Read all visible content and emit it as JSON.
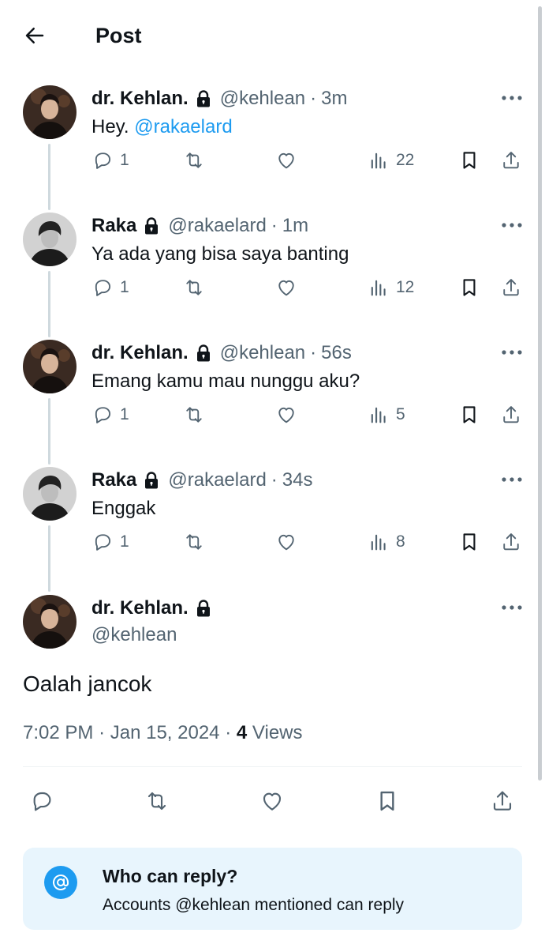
{
  "header": {
    "title": "Post"
  },
  "replies": [
    {
      "name": "dr. Kehlan.",
      "handle": "@kehlean",
      "time": "3m",
      "text": "Hey.",
      "mention": "@rakaelard",
      "reply_count": "1",
      "views": "22",
      "avatar": "dark-portrait"
    },
    {
      "name": "Raka",
      "handle": "@rakaelard",
      "time": "1m",
      "text": "Ya ada yang bisa saya banting",
      "mention": "",
      "reply_count": "1",
      "views": "12",
      "avatar": "grey-portrait"
    },
    {
      "name": "dr. Kehlan.",
      "handle": "@kehlean",
      "time": "56s",
      "text": "Emang kamu mau nunggu aku?",
      "mention": "",
      "reply_count": "1",
      "views": "5",
      "avatar": "dark-portrait"
    },
    {
      "name": "Raka",
      "handle": "@rakaelard",
      "time": "34s",
      "text": "Enggak",
      "mention": "",
      "reply_count": "1",
      "views": "8",
      "avatar": "grey-portrait"
    }
  ],
  "main_tweet": {
    "name": "dr. Kehlan.",
    "handle": "@kehlean",
    "text": "Oalah jancok",
    "time": "7:02 PM",
    "date": "Jan 15, 2024",
    "views_count": "4",
    "views_label": "Views"
  },
  "who_can_reply": {
    "title": "Who can reply?",
    "description": "Accounts @kehlean mentioned can reply"
  },
  "colors": {
    "accent": "#1d9bf0",
    "muted": "#536471",
    "text": "#0f1419",
    "card_bg": "#e8f5fd"
  },
  "icons": [
    "arrow-left-icon",
    "lock-icon",
    "more-icon",
    "reply-icon",
    "repost-icon",
    "like-icon",
    "views-icon",
    "bookmark-icon",
    "share-icon",
    "at-icon"
  ]
}
